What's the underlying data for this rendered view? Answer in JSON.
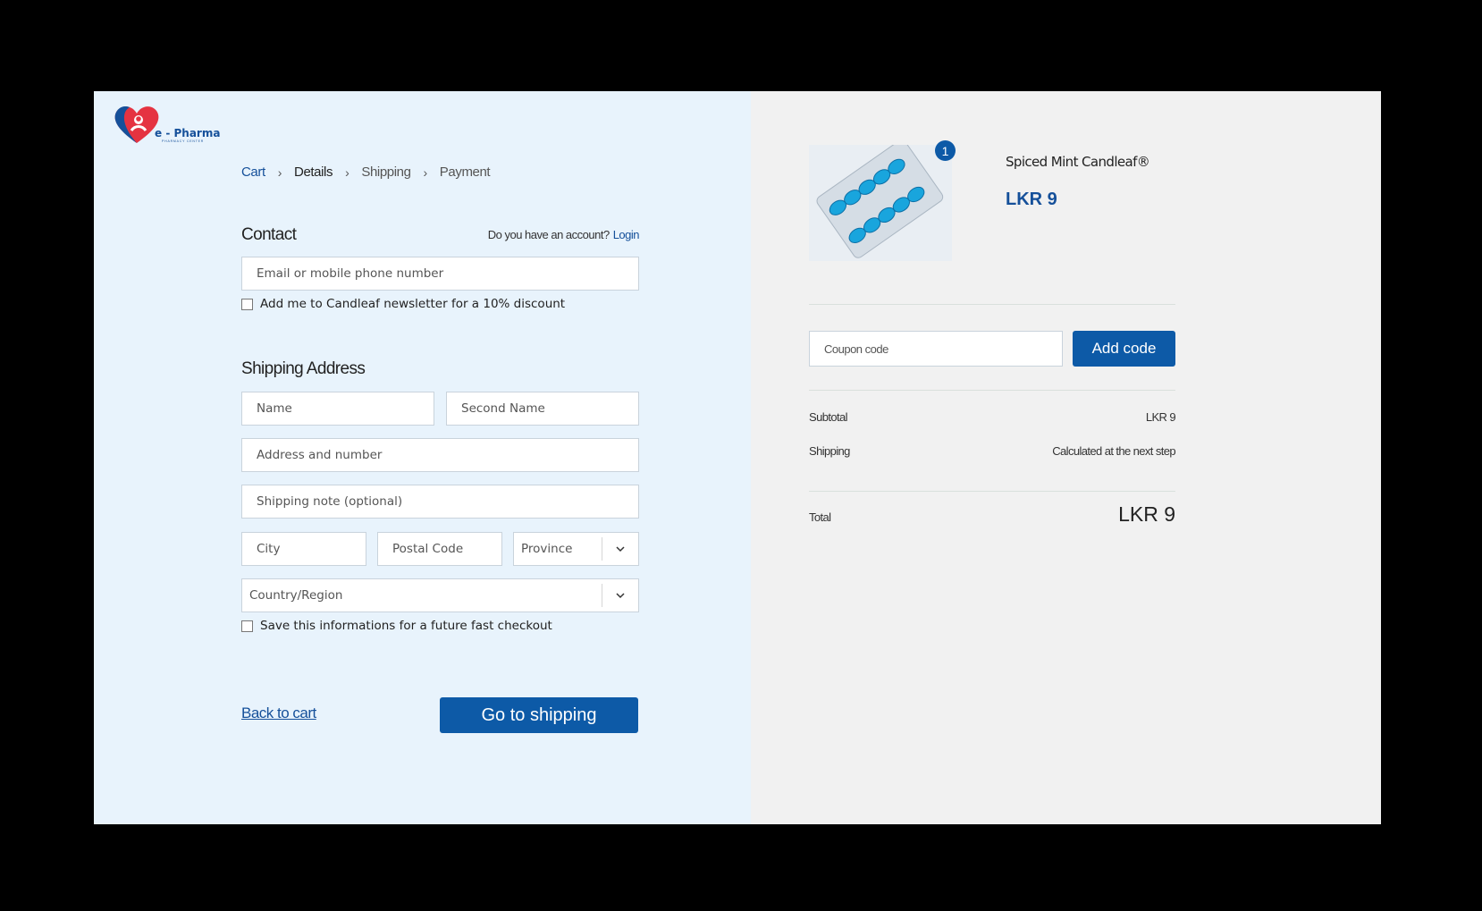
{
  "logo": {
    "text": "e - Pharma",
    "subtext": "PHARMACY CENTER"
  },
  "breadcrumb": {
    "items": [
      "Cart",
      "Details",
      "Shipping",
      "Payment"
    ],
    "separator": "›"
  },
  "contact": {
    "heading": "Contact",
    "account_question": "Do you have an account?",
    "login_label": "Login",
    "email_placeholder": "Email or mobile phone number",
    "newsletter_label": "Add me to Candleaf newsletter for a 10% discount"
  },
  "shipping_address": {
    "heading": "Shipping Address",
    "name_placeholder": "Name",
    "second_name_placeholder": "Second Name",
    "address_placeholder": "Address and number",
    "note_placeholder": "Shipping note (optional)",
    "city_placeholder": "City",
    "postal_placeholder": "Postal Code",
    "province_value": "Province",
    "country_value": "Country/Region",
    "save_label": "Save this informations for a future fast checkout"
  },
  "actions": {
    "back_label": "Back to cart",
    "go_label": "Go to shipping"
  },
  "order": {
    "quantity": "1",
    "product_name": "Spiced Mint Candleaf®",
    "product_price": "LKR 9",
    "coupon_placeholder": "Coupon code",
    "add_code_label": "Add code",
    "subtotal_label": "Subtotal",
    "subtotal_value": "LKR 9",
    "shipping_label": "Shipping",
    "shipping_value": "Calculated at the next step",
    "total_label": "Total",
    "total_value": "LKR 9"
  },
  "colors": {
    "brand_blue": "#0d5aa7",
    "left_bg": "#e8f3fc",
    "right_bg": "#f1f1f1",
    "logo_red": "#e53341"
  }
}
